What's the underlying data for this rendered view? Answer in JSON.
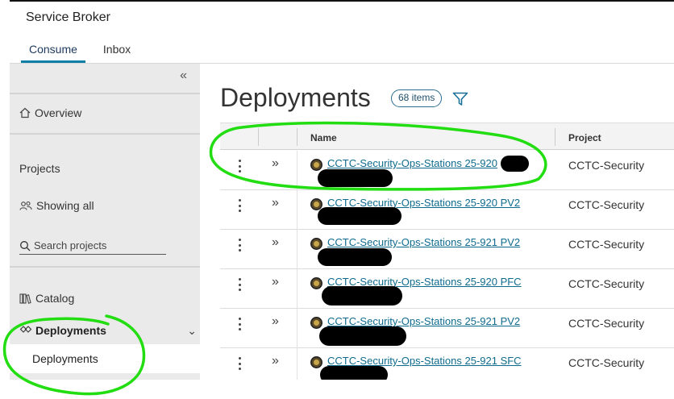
{
  "app": {
    "title": "Service Broker"
  },
  "tabs": [
    {
      "label": "Consume",
      "active": true
    },
    {
      "label": "Inbox",
      "active": false
    }
  ],
  "sidebar": {
    "collapse_icon": "double-chevron-left-icon",
    "overview": "Overview",
    "projects_heading": "Projects",
    "showing_all": "Showing all",
    "search_placeholder": "Search projects",
    "catalog": "Catalog",
    "deployments_group": "Deployments",
    "deployments_item": "Deployments"
  },
  "main": {
    "title": "Deployments",
    "count_badge": "68 items",
    "columns": [
      "Name",
      "Project"
    ],
    "rows": [
      {
        "name": "CCTC-Security-Ops-Stations 25-920",
        "project": "CCTC-Security"
      },
      {
        "name": "CCTC-Security-Ops-Stations 25-920 PV2",
        "project": "CCTC-Security"
      },
      {
        "name": "CCTC-Security-Ops-Stations 25-921 PV2",
        "project": "CCTC-Security"
      },
      {
        "name": "CCTC-Security-Ops-Stations 25-920 PFC",
        "project": "CCTC-Security"
      },
      {
        "name": "CCTC-Security-Ops-Stations 25-921 PV2",
        "project": "CCTC-Security"
      },
      {
        "name": "CCTC-Security-Ops-Stations 25-921 SFC",
        "project": "CCTC-Security"
      }
    ]
  },
  "colors": {
    "accent": "#0f7ea6",
    "link": "#0f6b8e",
    "sidebar_bg": "#eaeaea",
    "annotation": "#22dd11",
    "redaction": "#000000"
  }
}
